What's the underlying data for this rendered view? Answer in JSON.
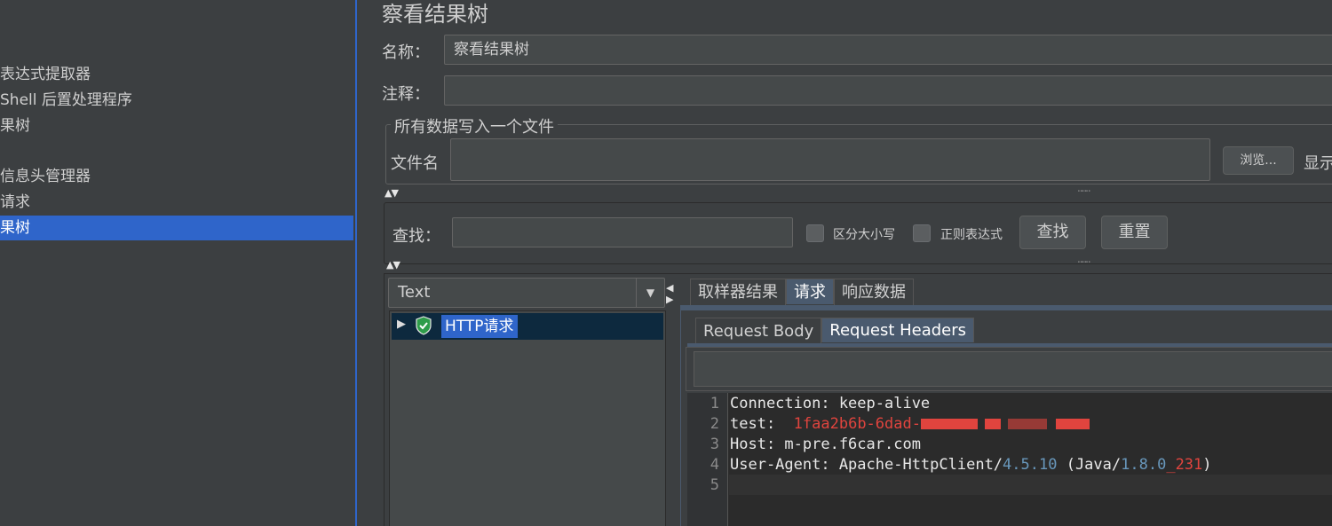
{
  "tree": {
    "items": [
      {
        "label": "表达式提取器",
        "selected": false
      },
      {
        "label": "Shell 后置处理程序",
        "selected": false
      },
      {
        "label": "果树",
        "selected": false
      },
      {
        "label": "信息头管理器",
        "selected": false
      },
      {
        "label": "请求",
        "selected": false
      },
      {
        "label": "果树",
        "selected": true
      }
    ]
  },
  "panel": {
    "title": "察看结果树",
    "name_label": "名称：",
    "name_value": "察看结果树",
    "comment_label": "注释：",
    "comment_value": "",
    "file_group_title": "所有数据写入一个文件",
    "filename_label": "文件名",
    "filename_value": "",
    "browse_label": "浏览...",
    "display_label": "显示"
  },
  "search": {
    "label": "查找：",
    "value": "",
    "case_label": "区分大小写",
    "case_checked": false,
    "regex_label": "正则表达式",
    "regex_checked": false,
    "find_label": "查找",
    "reset_label": "重置"
  },
  "results": {
    "renderer": "Text",
    "tree_items": [
      {
        "label": "HTTP请求",
        "status": "success"
      }
    ],
    "tabs": [
      {
        "label": "取样器结果",
        "active": false
      },
      {
        "label": "请求",
        "active": true
      },
      {
        "label": "响应数据",
        "active": false
      }
    ],
    "subtabs": [
      {
        "label": "Request Body",
        "active": false
      },
      {
        "label": "Request Headers",
        "active": true
      }
    ],
    "lines": [
      {
        "num": "1",
        "text": "Connection: keep-alive"
      },
      {
        "num": "2",
        "key": "test:",
        "value": "1faa2b6b-6dad-"
      },
      {
        "num": "3",
        "text": "Host: m-pre.f6car.com"
      },
      {
        "num": "4",
        "prefix": "User-Agent: Apache-HttpClient/",
        "v1": "4.5.10",
        "mid": " (Java/",
        "v2": "1.8.0",
        "sep": "_",
        "v3": "231",
        "suffix": ")"
      },
      {
        "num": "5",
        "text": ""
      }
    ]
  },
  "colors": {
    "selection": "#2f65ca",
    "background": "#3c3f41",
    "editor_bg": "#2b2b2b",
    "number": "#6897bb",
    "redacted": "#e0443e",
    "success_icon": "#2e9c4a"
  }
}
